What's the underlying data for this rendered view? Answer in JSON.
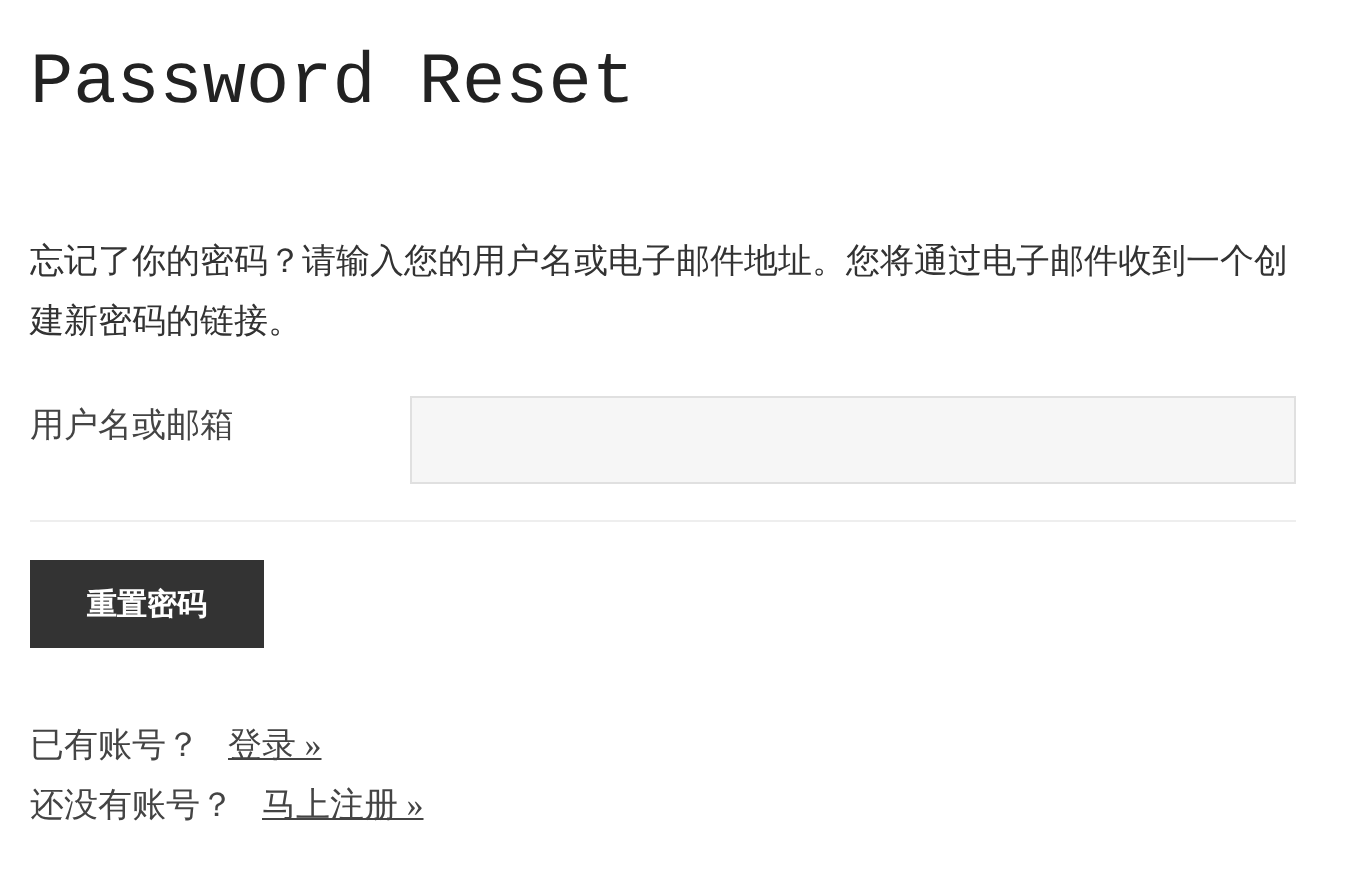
{
  "title": "Password Reset",
  "intro": "忘记了你的密码？请输入您的用户名或电子邮件地址。您将通过电子邮件收到一个创建新密码的链接。",
  "field": {
    "label": "用户名或邮箱"
  },
  "button": "重置密码",
  "links": [
    {
      "prompt": "已有账号？",
      "link": "登录 »"
    },
    {
      "prompt": "还没有账号？",
      "link": "马上注册 »"
    }
  ]
}
